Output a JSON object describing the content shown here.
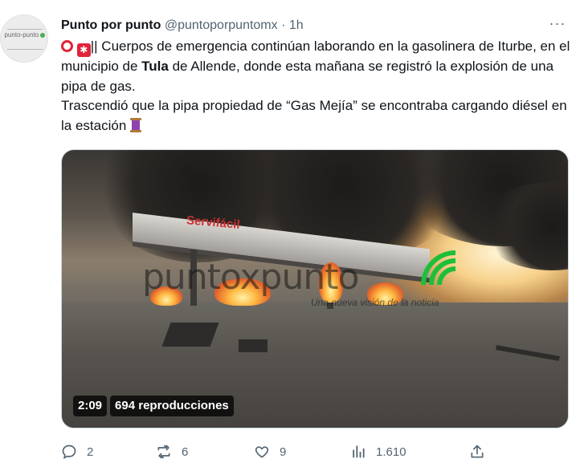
{
  "post": {
    "author_name": "Punto por punto",
    "handle": "@puntoporpuntomx",
    "separator": "·",
    "time": "1h",
    "more_label": "···",
    "avatar_text": "punto-punto",
    "text_line1_after_emoji": "|| Cuerpos de emergencia continúan laborando en la gasolinera de Iturbe, en el municipio de ",
    "text_bold": "Tula",
    "text_line1_end": " de Allende, donde esta mañana se registró la explosión de una pipa de gas.",
    "text_line2": "Trascendió que la pipa propiedad de “Gas Mejía” se encontraba cargando diésel en la estación ",
    "emojis": [
      "red-circle-emoji",
      "sos-emoji",
      "thread-spool-emoji"
    ]
  },
  "media": {
    "canopy_brand": "Servifácil",
    "watermark": "puntoxpunto",
    "watermark_tagline": "Una nueva visión de la noticia",
    "duration": "2:09",
    "views": "694 reproducciones"
  },
  "actions": {
    "replies": "2",
    "reposts": "6",
    "likes": "9",
    "views": "1.610",
    "icons": [
      "reply-icon",
      "repost-icon",
      "like-icon",
      "views-icon",
      "share-icon"
    ]
  },
  "colors": {
    "text": "#0f1419",
    "secondary": "#536471",
    "emoji_red": "#e0243a"
  }
}
